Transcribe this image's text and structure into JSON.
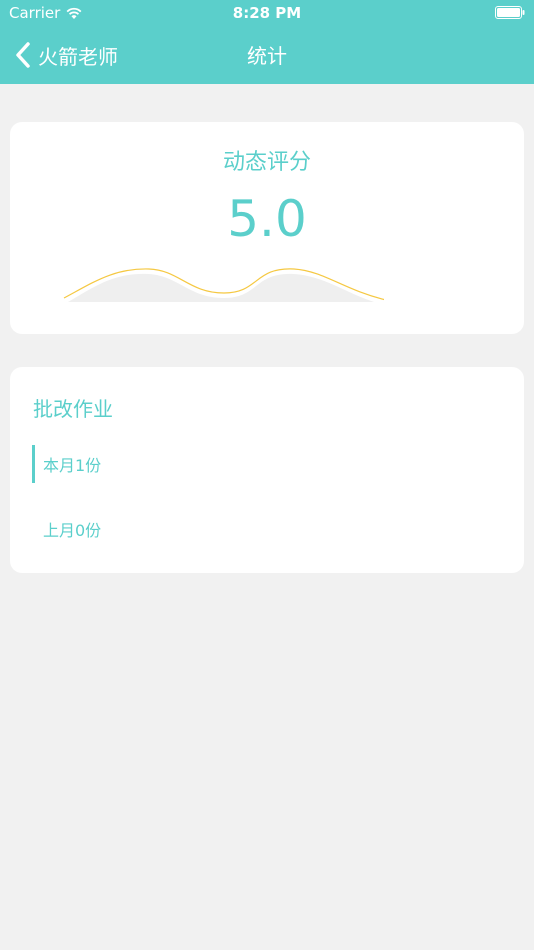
{
  "status_bar": {
    "carrier": "Carrier",
    "time": "8:28 PM"
  },
  "nav": {
    "back_label": "火箭老师",
    "title": "统计"
  },
  "score_card": {
    "title": "动态评分",
    "value": "5.0"
  },
  "homework": {
    "title": "批改作业",
    "items": [
      {
        "label": "本月1份",
        "active": true
      },
      {
        "label": "上月0份",
        "active": false
      }
    ]
  },
  "colors": {
    "accent": "#5bcfcb",
    "background": "#f1f1f1",
    "wave_line": "#f5c842",
    "wave_fill": "#efefef"
  },
  "icons": {
    "back": "chevron-left-icon",
    "wifi": "wifi-icon",
    "battery": "battery-icon"
  }
}
